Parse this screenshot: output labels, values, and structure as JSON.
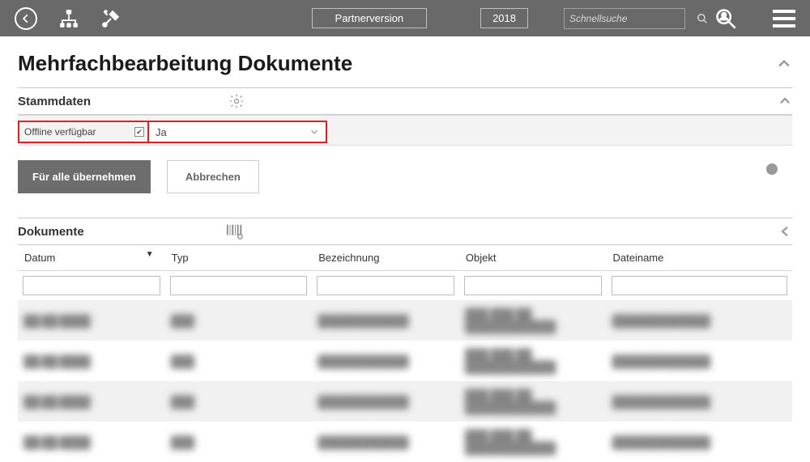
{
  "topbar": {
    "partner_label": "Partnerversion",
    "year_label": "2018",
    "search_placeholder": "Schnellsuche"
  },
  "page": {
    "title": "Mehrfachbearbeitung Dokumente"
  },
  "stammdaten": {
    "section_label": "Stammdaten",
    "offline_label": "Offline verfügbar",
    "offline_value": "Ja"
  },
  "actions": {
    "apply_all": "Für alle übernehmen",
    "cancel": "Abbrechen"
  },
  "dokumente": {
    "section_label": "Dokumente",
    "columns": {
      "datum": "Datum",
      "typ": "Typ",
      "bezeichnung": "Bezeichnung",
      "objekt": "Objekt",
      "dateiname": "Dateiname"
    },
    "rows": [
      {
        "datum": "██.██.████",
        "typ": "███",
        "bezeichnung": "████████████",
        "objekt": "███ ███ ██ ████████████",
        "dateiname": "█████████████"
      },
      {
        "datum": "██.██.████",
        "typ": "███",
        "bezeichnung": "████████████",
        "objekt": "███ ███ ██ ████████████",
        "dateiname": "█████████████"
      },
      {
        "datum": "██.██.████",
        "typ": "███",
        "bezeichnung": "████████████",
        "objekt": "███ ███ ██ ████████████",
        "dateiname": "█████████████"
      },
      {
        "datum": "██.██.████",
        "typ": "███",
        "bezeichnung": "████████████",
        "objekt": "███ ███ ██ ████████████",
        "dateiname": "█████████████"
      }
    ]
  }
}
